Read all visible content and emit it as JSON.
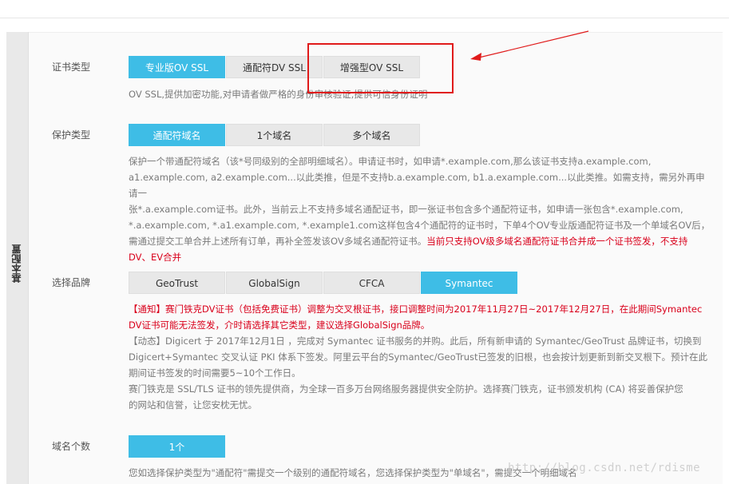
{
  "side_tab": {
    "label": "基本配置"
  },
  "cert_type": {
    "label": "证书类型",
    "options": [
      "专业版OV SSL",
      "通配符DV SSL",
      "增强型OV SSL"
    ],
    "selected_index": 0,
    "desc": "OV SSL,提供加密功能,对申请者做严格的身份审核验证,提供可信身份证明"
  },
  "protect_type": {
    "label": "保护类型",
    "options": [
      "通配符域名",
      "1个域名",
      "多个域名"
    ],
    "selected_index": 0,
    "desc_lines": [
      "保护一个带通配符域名（该*号同级别的全部明细域名）。申请证书时，如申请*.example.com,那么该证书支持a.example.com,",
      "a1.example.com, a2.example.com...以此类推，但是不支持b.a.example.com, b1.a.example.com...以此类推。如需支持，需另外再申请一",
      "张*.a.example.com证书。此外，当前云上不支持多域名通配证书，即一张证书包含多个通配符证书，如申请一张包含*.example.com,",
      "*.a.example.com, *.a1.example.com, *.example1.com这样包含4个通配符的证书时，下单4个OV专业版通配符证书及一个单域名OV后，"
    ],
    "desc_last_normal": "需通过提交工单合并上述所有订单，再补全签发该OV多域名通配符证书。",
    "desc_last_red_1": "当前只支持OV级多域名通配符证书合并成一个证书签发，不支持",
    "desc_last_red_2": "DV、EV合并"
  },
  "brand": {
    "label": "选择品牌",
    "options": [
      "GeoTrust",
      "GlobalSign",
      "CFCA",
      "Symantec"
    ],
    "selected_index": 3,
    "notice_line1": "【通知】赛门铁克DV证书（包括免费证书）调整为交叉根证书，接口调整时间为2017年11月27日~2017年12月27日，在此期间Symantec",
    "notice_line2": "DV证书可能无法签发，介时请选择其它类型，建议选择GlobalSign品牌。",
    "news_line1": "【动态】Digicert 于 2017年12月1日 ，完成对 Symantec 证书服务的并购。此后，所有新申请的 Symantec/GeoTrust 品牌证书，切换到",
    "news_line2": "Digicert+Symantec 交叉认证 PKI 体系下签发。阿里云平台的Symantec/GeoTrust已签发的旧根，也会按计划更新到新交叉根下。预计在此",
    "news_line3": "期间证书签发的时间需要5~10个工作日。",
    "about_line1": "赛门铁克是 SSL/TLS 证书的领先提供商，为全球一百多万台网络服务器提供安全防护。选择赛门铁克，证书颁发机构 (CA) 将妥善保护您",
    "about_line2": "的网站和信誉，让您安枕无忧。"
  },
  "domain_count": {
    "label": "域名个数",
    "value": "1个",
    "desc": "您如选择保护类型为\"通配符\"需提交一个级别的通配符域名，您选择保护类型为\"单域名\"，需提交一个明细域名"
  },
  "watermark": "http://blog.csdn.net/rdisme",
  "colors": {
    "accent": "#3ebde6",
    "annotation": "#e01a1a",
    "notice_red": "#d9001b"
  }
}
